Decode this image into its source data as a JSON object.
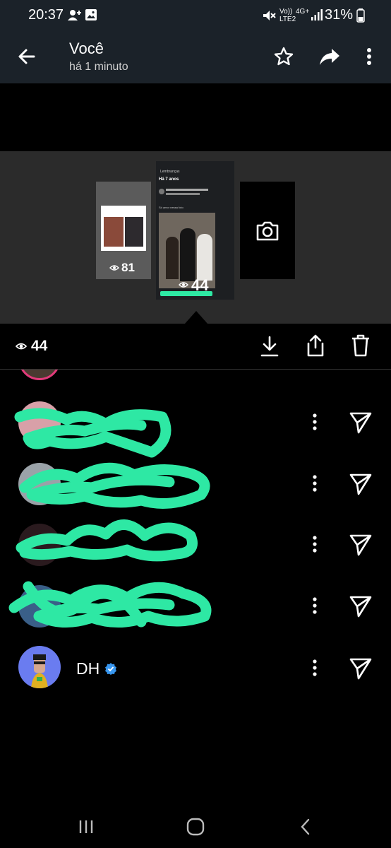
{
  "status_bar": {
    "time": "20:37",
    "network_label_top": "Vo))",
    "network_label_bottom": "LTE2",
    "network_type": "4G+",
    "battery": "31%"
  },
  "header": {
    "title": "Você",
    "subtitle": "há 1 minuto"
  },
  "story_strip": {
    "left_view_count": "81",
    "center_view_count": "44",
    "center_post": {
      "back_label": "Lembranças",
      "ago": "Há 7 anos",
      "caption": "Só amor nessa foto"
    }
  },
  "action_bar": {
    "view_count": "44"
  },
  "viewers": [
    {
      "name": "",
      "scribbled": true
    },
    {
      "name": "",
      "scribbled": true
    },
    {
      "name": "",
      "scribbled": true
    },
    {
      "name": "",
      "scribbled": true
    },
    {
      "name": "DH",
      "verified": true
    }
  ],
  "colors": {
    "header_bg": "#1b2229",
    "strip_bg": "#2b2b2b",
    "scribble": "#2ee8a4",
    "verified": "#3897f0"
  }
}
